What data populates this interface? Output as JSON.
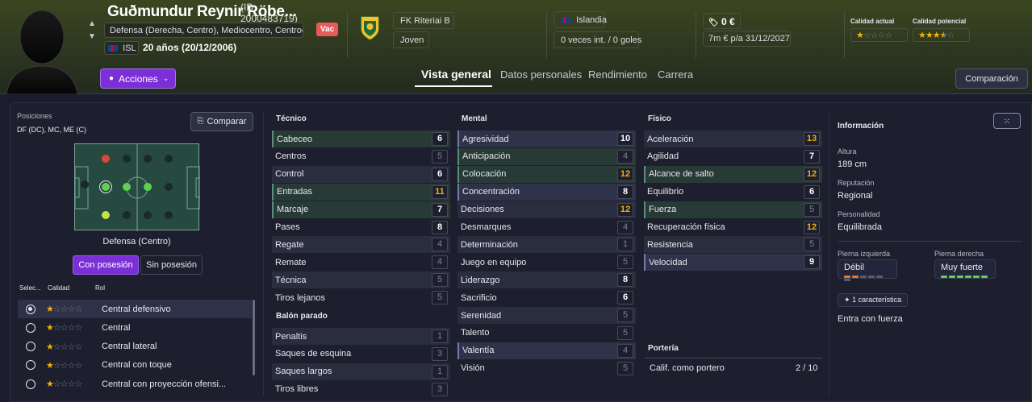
{
  "header": {
    "player_name": "Guðmundur Reynir Röbe...",
    "player_id": "(ID: 2000483719)",
    "positions_text": "Defensa (Derecha, Centro), Mediocentro, Centroc...",
    "nationality_code": "ISL",
    "age_text": "20 años (20/12/2006)",
    "tag": "Vac",
    "club": "FK Riteriai B",
    "status": "Joven",
    "nation": "Islandia",
    "caps": "0 veces int. / 0 goles",
    "value": "0 €",
    "contract_wage": "7m € p/a",
    "contract_date": "31/12/2027",
    "current_ability_label": "Calidad actual",
    "current_ability_stars": 1,
    "potential_ability_label": "Calidad potencial",
    "potential_ability_stars": 3.5,
    "actions_label": "Acciones",
    "compare_label": "Comparación",
    "tabs": [
      "Vista general",
      "Datos personales",
      "Rendimiento",
      "Carrera"
    ],
    "active_tab": 0
  },
  "left": {
    "positions_title": "Posiciones",
    "positions_value": "DF (DC), MC, ME (C)",
    "compare_button": "Comparar",
    "pitch_role_label": "Defensa (Centro)",
    "toggle_on": "Con posesión",
    "toggle_off": "Sin posesión",
    "col_select": "Selec...",
    "col_quality": "Calidad",
    "col_role": "Rol",
    "roles": [
      {
        "name": "Central defensivo",
        "stars": 1,
        "selected": true
      },
      {
        "name": "Central",
        "stars": 1,
        "selected": false
      },
      {
        "name": "Central lateral",
        "stars": 1,
        "selected": false
      },
      {
        "name": "Central con toque",
        "stars": 1,
        "selected": false
      },
      {
        "name": "Central con proyección ofensi...",
        "stars": 1,
        "selected": false
      }
    ]
  },
  "technical": {
    "title": "Técnico",
    "items": [
      {
        "name": "Cabeceo",
        "value": "6",
        "style": "gr",
        "color": "w"
      },
      {
        "name": "Centros",
        "value": "5",
        "style": "",
        "color": "g"
      },
      {
        "name": "Control",
        "value": "6",
        "style": "",
        "color": "w"
      },
      {
        "name": "Entradas",
        "value": "11",
        "style": "gr",
        "color": "o"
      },
      {
        "name": "Marcaje",
        "value": "7",
        "style": "gr",
        "color": "w"
      },
      {
        "name": "Pases",
        "value": "8",
        "style": "",
        "color": "w"
      },
      {
        "name": "Regate",
        "value": "4",
        "style": "",
        "color": "g"
      },
      {
        "name": "Remate",
        "value": "4",
        "style": "",
        "color": "g"
      },
      {
        "name": "Técnica",
        "value": "5",
        "style": "",
        "color": "g"
      },
      {
        "name": "Tiros lejanos",
        "value": "5",
        "style": "",
        "color": "g"
      }
    ]
  },
  "setpieces": {
    "title": "Balón parado",
    "items": [
      {
        "name": "Penaltis",
        "value": "1",
        "style": "",
        "color": "g"
      },
      {
        "name": "Saques de esquina",
        "value": "3",
        "style": "",
        "color": "g"
      },
      {
        "name": "Saques largos",
        "value": "1",
        "style": "",
        "color": "g"
      },
      {
        "name": "Tiros libres",
        "value": "3",
        "style": "",
        "color": "g"
      }
    ]
  },
  "mental": {
    "title": "Mental",
    "items": [
      {
        "name": "Agresividad",
        "value": "10",
        "style": "hl",
        "color": "w"
      },
      {
        "name": "Anticipación",
        "value": "4",
        "style": "gr",
        "color": "g"
      },
      {
        "name": "Colocación",
        "value": "12",
        "style": "gr",
        "color": "o"
      },
      {
        "name": "Concentración",
        "value": "8",
        "style": "hl",
        "color": "w"
      },
      {
        "name": "Decisiones",
        "value": "12",
        "style": "",
        "color": "o"
      },
      {
        "name": "Desmarques",
        "value": "4",
        "style": "",
        "color": "g"
      },
      {
        "name": "Determinación",
        "value": "1",
        "style": "",
        "color": "g"
      },
      {
        "name": "Juego en equipo",
        "value": "5",
        "style": "",
        "color": "g"
      },
      {
        "name": "Liderazgo",
        "value": "8",
        "style": "",
        "color": "w"
      },
      {
        "name": "Sacrificio",
        "value": "6",
        "style": "",
        "color": "w"
      },
      {
        "name": "Serenidad",
        "value": "5",
        "style": "",
        "color": "g"
      },
      {
        "name": "Talento",
        "value": "5",
        "style": "",
        "color": "g"
      },
      {
        "name": "Valentía",
        "value": "4",
        "style": "hl",
        "color": "g"
      },
      {
        "name": "Visión",
        "value": "5",
        "style": "",
        "color": "g"
      }
    ]
  },
  "physical": {
    "title": "Físico",
    "items": [
      {
        "name": "Aceleración",
        "value": "13",
        "style": "",
        "color": "o"
      },
      {
        "name": "Agilidad",
        "value": "7",
        "style": "",
        "color": "w"
      },
      {
        "name": "Alcance de salto",
        "value": "12",
        "style": "gr",
        "color": "o"
      },
      {
        "name": "Equilibrio",
        "value": "6",
        "style": "",
        "color": "w"
      },
      {
        "name": "Fuerza",
        "value": "5",
        "style": "gr",
        "color": "g"
      },
      {
        "name": "Recuperación física",
        "value": "12",
        "style": "",
        "color": "o"
      },
      {
        "name": "Resistencia",
        "value": "5",
        "style": "",
        "color": "g"
      },
      {
        "name": "Velocidad",
        "value": "9",
        "style": "hl",
        "color": "w"
      }
    ]
  },
  "goalkeeping": {
    "title": "Portería",
    "label": "Calif. como portero",
    "value": "2 / 10"
  },
  "info": {
    "title": "Información",
    "height_label": "Altura",
    "height_value": "189 cm",
    "reputation_label": "Reputación",
    "reputation_value": "Regional",
    "personality_label": "Personalidad",
    "personality_value": "Equilibrada",
    "left_foot_label": "Pierna izquierda",
    "left_foot_value": "Débil",
    "left_foot_level": 2,
    "right_foot_label": "Pierna derecha",
    "right_foot_value": "Muy fuerte",
    "right_foot_level": 6,
    "traits_badge": "1 característica",
    "trait": "Entra con fuerza"
  },
  "colors": {
    "accent": "#7b2fd6",
    "high_value": "#f0b400",
    "star": "#f0b400",
    "foot_weak": "#e8782c",
    "foot_strong": "#5fd04f"
  }
}
